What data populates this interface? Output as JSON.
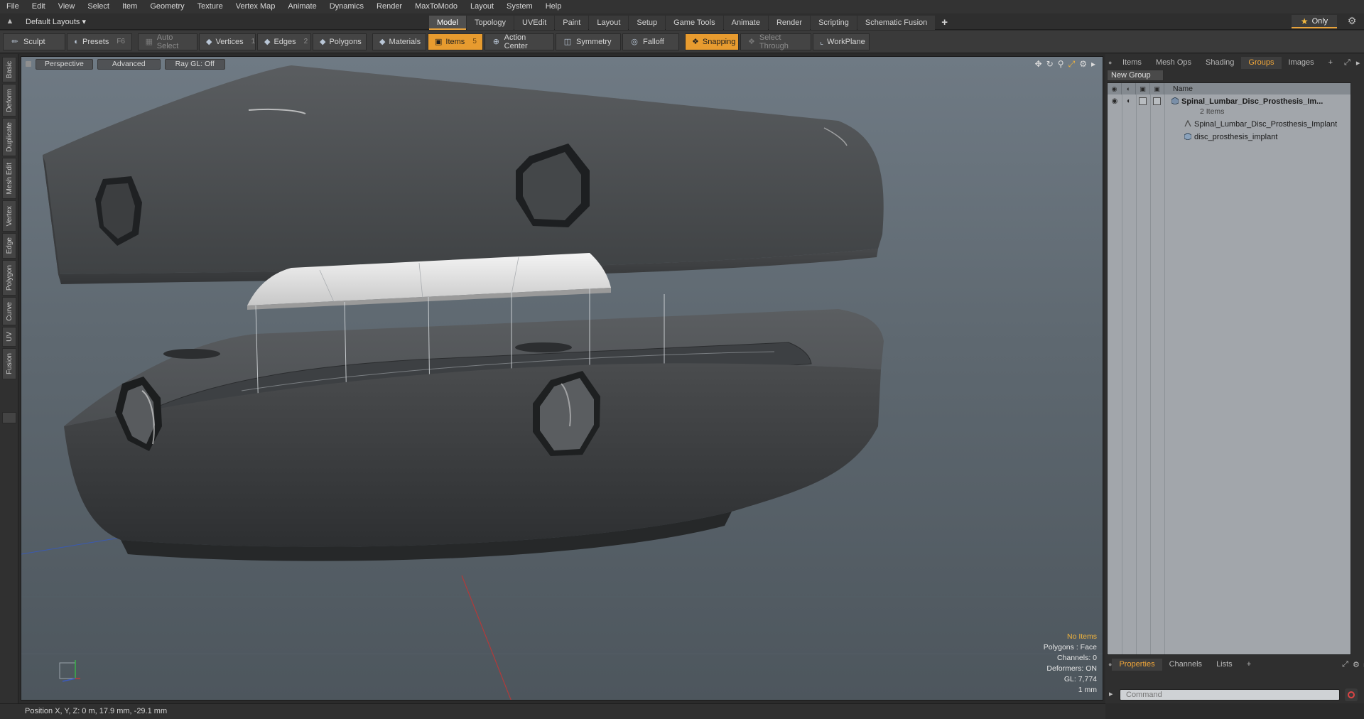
{
  "menu": [
    "File",
    "Edit",
    "View",
    "Select",
    "Item",
    "Geometry",
    "Texture",
    "Vertex Map",
    "Animate",
    "Dynamics",
    "Render",
    "MaxToModo",
    "Layout",
    "System",
    "Help"
  ],
  "layout": {
    "label": "Default Layouts ▾"
  },
  "mode_tabs": [
    {
      "label": "Model",
      "active": true
    },
    {
      "label": "Topology"
    },
    {
      "label": "UVEdit"
    },
    {
      "label": "Paint"
    },
    {
      "label": "Layout"
    },
    {
      "label": "Setup"
    },
    {
      "label": "Game Tools"
    },
    {
      "label": "Animate"
    },
    {
      "label": "Render"
    },
    {
      "label": "Scripting"
    },
    {
      "label": "Schematic Fusion"
    }
  ],
  "only_label": "Only",
  "toolbar": {
    "sculpt": "Sculpt",
    "presets": "Presets",
    "presets_key": "F6",
    "auto_select": "Auto Select",
    "vertices": "Vertices",
    "vertices_count": "1",
    "edges": "Edges",
    "edges_count": "2",
    "polygons": "Polygons",
    "materials": "Materials",
    "items": "Items",
    "items_count": "5",
    "action_center": "Action Center",
    "symmetry": "Symmetry",
    "falloff": "Falloff",
    "snapping": "Snapping",
    "select_through": "Select Through",
    "workplane": "WorkPlane"
  },
  "left_tabs": [
    "Basic",
    "Deform",
    "Duplicate",
    "Mesh Edit",
    "Vertex",
    "Edge",
    "Polygon",
    "Curve",
    "UV",
    "Fusion"
  ],
  "viewport": {
    "view": "Perspective",
    "shading": "Advanced",
    "raygl": "Ray GL: Off",
    "info": {
      "selection": "No Items",
      "polygons": "Polygons : Face",
      "channels": "Channels: 0",
      "deformers": "Deformers: ON",
      "gl": "GL: 7,774",
      "unit": "1 mm"
    }
  },
  "right_panel": {
    "tabs": [
      {
        "label": "Items"
      },
      {
        "label": "Mesh Ops"
      },
      {
        "label": "Shading"
      },
      {
        "label": "Groups",
        "active": true
      },
      {
        "label": "Images"
      },
      {
        "label": "+"
      }
    ],
    "new_group": "New Group",
    "name_header": "Name",
    "tree": {
      "group_name": "Spinal_Lumbar_Disc_Prosthesis_Im...",
      "group_count": "2 Items",
      "child1": "Spinal_Lumbar_Disc_Prosthesis_Implant",
      "child2": "disc_prosthesis_implant"
    },
    "bottom_tabs": [
      {
        "label": "Properties",
        "active": true
      },
      {
        "label": "Channels"
      },
      {
        "label": "Lists"
      },
      {
        "label": "+"
      }
    ],
    "command_placeholder": "Command"
  },
  "status": {
    "position": "Position X, Y, Z:  0 m, 17.9 mm, -29.1 mm"
  },
  "colors": {
    "accent": "#e8a33c",
    "viewport_bg": "#66717a",
    "list_bg": "#a2a6ab"
  }
}
